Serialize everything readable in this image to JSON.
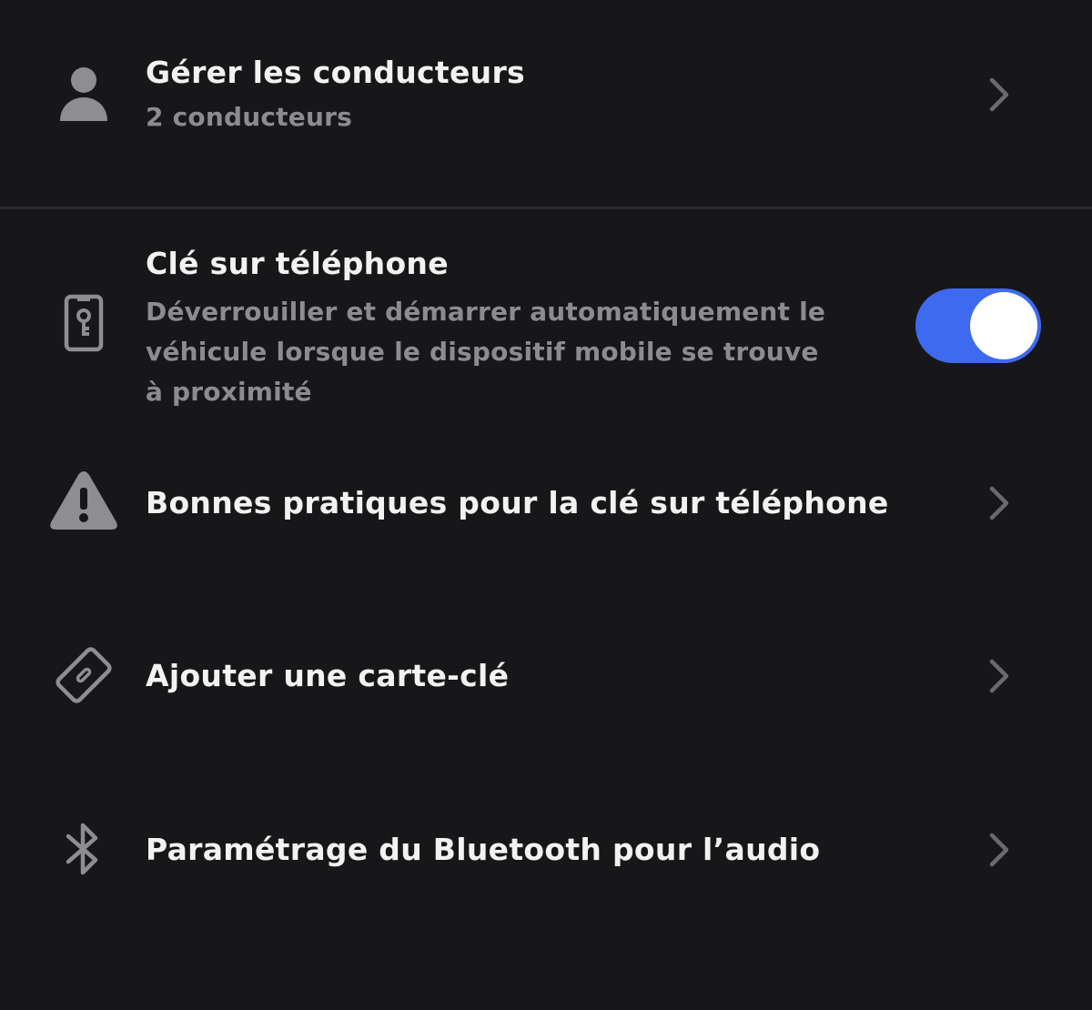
{
  "settings": {
    "drivers": {
      "title": "Gérer les conducteurs",
      "subtitle": "2 conducteurs",
      "icon": "person-icon"
    },
    "phone_key": {
      "title": "Clé sur téléphone",
      "description": "Déverrouiller et démarrer automatiquement le véhicule lorsque le dispositif mobile se trouve à proximité",
      "enabled": true,
      "icon": "phone-key-icon"
    },
    "best_practices": {
      "title": "Bonnes pratiques pour la clé sur téléphone",
      "icon": "warning-icon"
    },
    "key_card": {
      "title": "Ajouter une carte-clé",
      "icon": "key-card-icon"
    },
    "bluetooth": {
      "title": "Paramétrage du Bluetooth pour l’audio",
      "icon": "bluetooth-icon"
    }
  },
  "colors": {
    "background": "#171719",
    "toggle_on": "#3e6af0",
    "icon": "#8e8e92",
    "subtitle": "#8c8c90"
  }
}
